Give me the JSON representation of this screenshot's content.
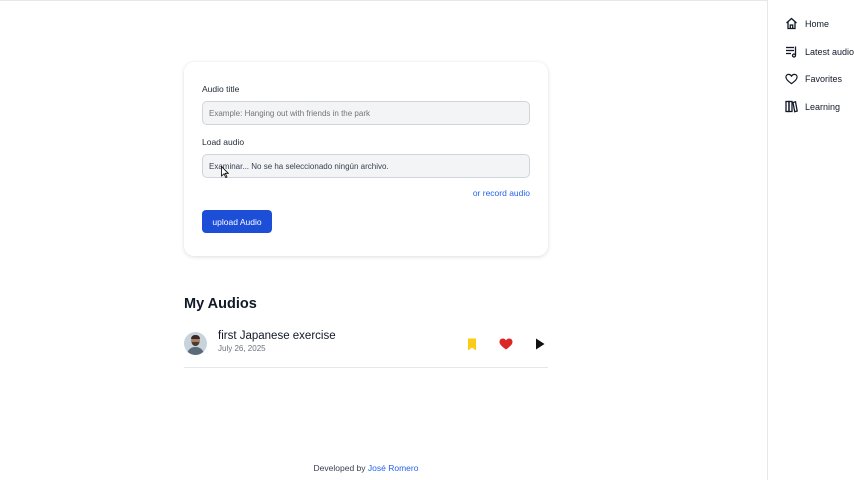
{
  "upload_form": {
    "title_label": "Audio title",
    "title_placeholder": "Example: Hanging out with friends in the park",
    "file_label": "Load audio",
    "file_value": "Examinar... No se ha seleccionado ningún archivo.",
    "record_link": "or record audio",
    "upload_button": "upload Audio"
  },
  "my_audios": {
    "heading": "My Audios",
    "items": [
      {
        "title": "first Japanese exercise",
        "date": "July 26, 2025",
        "bookmark_color": "#facc15",
        "heart_color": "#dc2626"
      }
    ]
  },
  "footer": {
    "prefix": "Developed by",
    "author": "José Romero"
  },
  "sidebar": {
    "items": [
      {
        "label": "Home",
        "icon": "home-icon"
      },
      {
        "label": "Latest audios",
        "icon": "list-icon"
      },
      {
        "label": "Favorites",
        "icon": "heart-icon"
      },
      {
        "label": "Learning",
        "icon": "books-icon"
      }
    ]
  },
  "colors": {
    "accent": "#1d4ed8",
    "link": "#2563eb"
  }
}
